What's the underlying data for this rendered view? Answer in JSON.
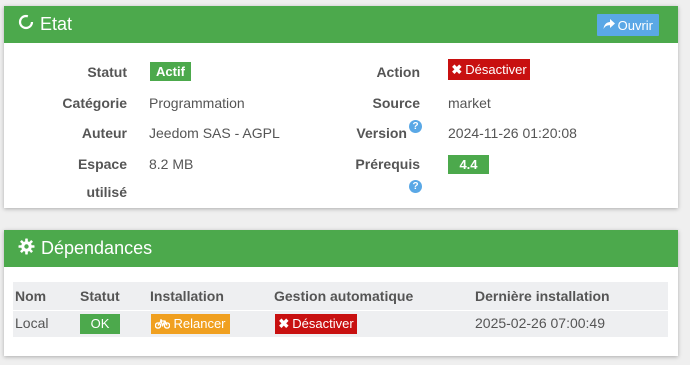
{
  "etat": {
    "title": "Etat",
    "open_button": "Ouvrir",
    "left": {
      "statut_label": "Statut",
      "statut_value": "Actif",
      "categorie_label": "Catégorie",
      "categorie_value": "Programmation",
      "auteur_label": "Auteur",
      "auteur_value": "Jeedom SAS - AGPL",
      "espace_label_1": "Espace",
      "espace_label_2": "utilisé",
      "espace_value": "8.2 MB"
    },
    "right": {
      "action_label": "Action",
      "action_button": "Désactiver",
      "source_label": "Source",
      "source_value": "market",
      "version_label": "Version",
      "version_value": "2024-11-26 01:20:08",
      "prerequis_label": "Prérequis",
      "prerequis_value": "4.4"
    }
  },
  "dependances": {
    "title": "Dépendances",
    "columns": [
      "Nom",
      "Statut",
      "Installation",
      "Gestion automatique",
      "Dernière installation"
    ],
    "rows": [
      {
        "nom": "Local",
        "statut": "OK",
        "installation": "Relancer",
        "gestion": "Désactiver",
        "derniere": "2025-02-26 07:00:49"
      }
    ]
  },
  "colors": {
    "header_green": "#4ca94c",
    "danger_red": "#c81010",
    "warning_orange": "#f0a020",
    "info_blue": "#5aa8e6"
  }
}
